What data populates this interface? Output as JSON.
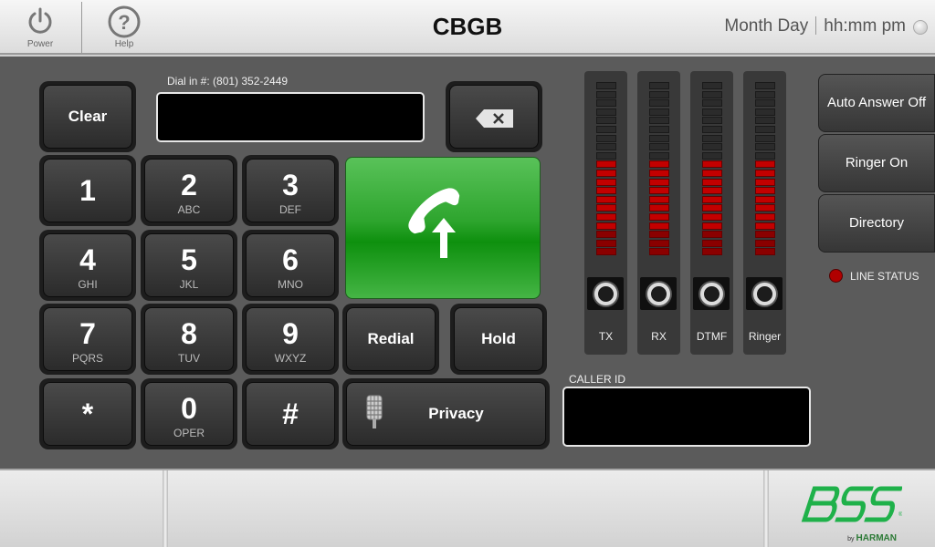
{
  "header": {
    "power_label": "Power",
    "help_label": "Help",
    "room_title": "CBGB",
    "date_text": "Month Day",
    "time_text": "hh:mm pm"
  },
  "dialer": {
    "dial_in_label": "Dial in #: (801) 352-2449",
    "dial_value": "",
    "clear_label": "Clear",
    "keys": [
      {
        "num": "1",
        "letters": ""
      },
      {
        "num": "2",
        "letters": "ABC"
      },
      {
        "num": "3",
        "letters": "DEF"
      },
      {
        "num": "4",
        "letters": "GHI"
      },
      {
        "num": "5",
        "letters": "JKL"
      },
      {
        "num": "6",
        "letters": "MNO"
      },
      {
        "num": "7",
        "letters": "PQRS"
      },
      {
        "num": "8",
        "letters": "TUV"
      },
      {
        "num": "9",
        "letters": "WXYZ"
      },
      {
        "num": "*",
        "letters": ""
      },
      {
        "num": "0",
        "letters": "OPER"
      },
      {
        "num": "#",
        "letters": ""
      }
    ],
    "redial_label": "Redial",
    "hold_label": "Hold",
    "privacy_label": "Privacy"
  },
  "meters": [
    {
      "label": "TX",
      "level_segments_lit": 11,
      "total_segments": 20
    },
    {
      "label": "RX",
      "level_segments_lit": 11,
      "total_segments": 20
    },
    {
      "label": "DTMF",
      "level_segments_lit": 11,
      "total_segments": 20
    },
    {
      "label": "Ringer",
      "level_segments_lit": 11,
      "total_segments": 20
    }
  ],
  "side": {
    "auto_answer_label": "Auto Answer Off",
    "ringer_label": "Ringer On",
    "directory_label": "Directory",
    "line_status_label": "LINE STATUS"
  },
  "caller_id": {
    "label": "CALLER ID",
    "value": ""
  },
  "brand": {
    "logo_text": "BSS",
    "by_text": "by",
    "harman_text": "HARMAN"
  },
  "colors": {
    "call_green": "#2ea52e",
    "meter_red": "#c30000",
    "line_status_red": "#b00000",
    "logo_green": "#1fb14a"
  }
}
